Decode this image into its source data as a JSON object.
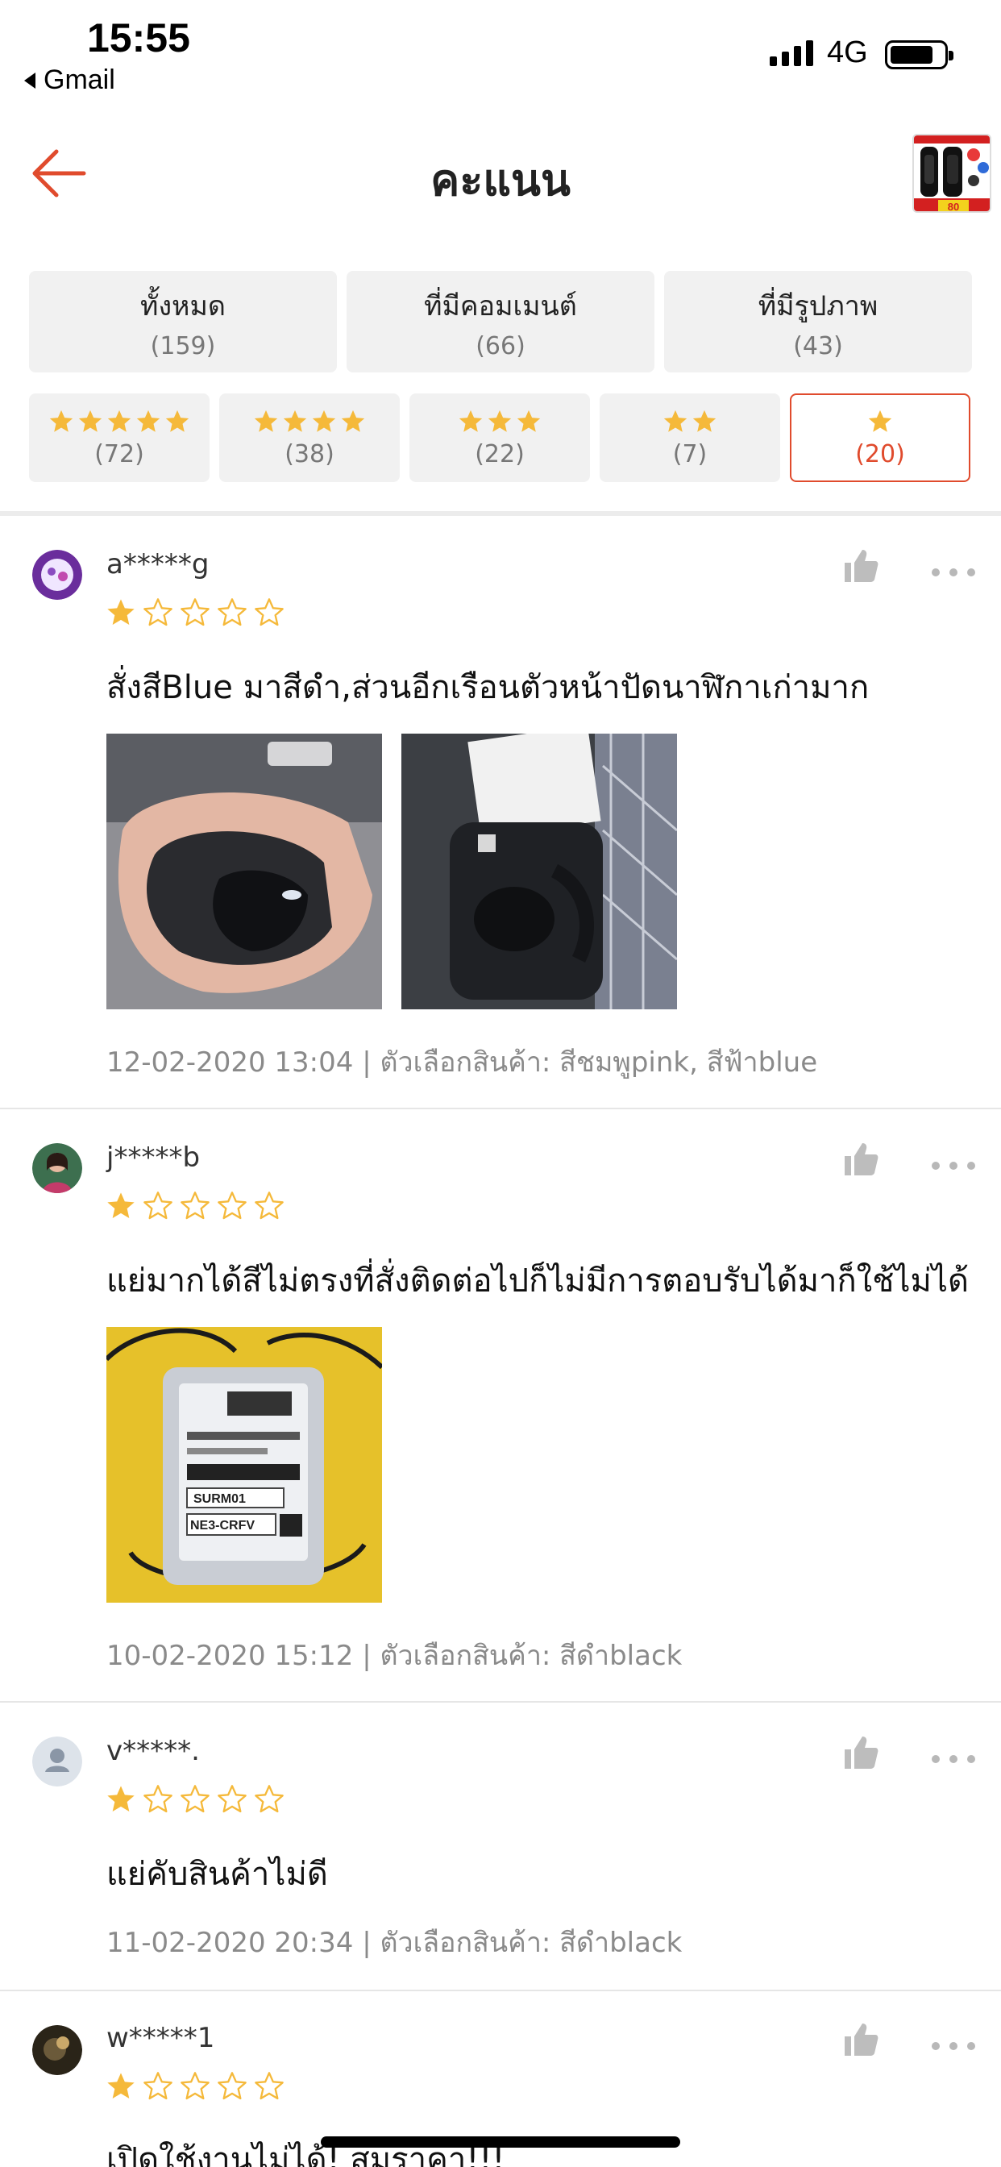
{
  "status_bar": {
    "time": "15:55",
    "back_app": "Gmail",
    "network": "4G"
  },
  "header": {
    "title": "คะแนน",
    "product_thumb_text": "80"
  },
  "filters": {
    "top": [
      {
        "label": "ทั้งหมด",
        "count": "(159)"
      },
      {
        "label": "ที่มีคอมเมนต์",
        "count": "(66)"
      },
      {
        "label": "ที่มีรูปภาพ",
        "count": "(43)"
      }
    ],
    "stars": [
      {
        "stars": 5,
        "count": "(72)",
        "active": false
      },
      {
        "stars": 4,
        "count": "(38)",
        "active": false
      },
      {
        "stars": 3,
        "count": "(22)",
        "active": false
      },
      {
        "stars": 2,
        "count": "(7)",
        "active": false
      },
      {
        "stars": 1,
        "count": "(20)",
        "active": true
      }
    ]
  },
  "reviews": [
    {
      "username": "a*****g",
      "rating": 1,
      "text": "สั่งสีBlue มาสีดำ,ส่วนอีกเรือนตัวหน้าปัดนาฬิกาเก่ามาก",
      "photo_count": 2,
      "meta": "12-02-2020 13:04 | ตัวเลือกสินค้า: สีชมพูpink, สีฟ้าblue"
    },
    {
      "username": "j*****b",
      "rating": 1,
      "text": "แย่มากได้สีไม่ตรงที่สั่งติดต่อไปก็ไม่มีการตอบรับได้มาก็ใช้ไม่ได้",
      "photo_count": 1,
      "photo_label_1": "SURM01",
      "photo_label_2": "NE3-CRFV",
      "meta": "10-02-2020 15:12 | ตัวเลือกสินค้า: สีดำblack"
    },
    {
      "username": "v*****.",
      "rating": 1,
      "text": "แย่คับสินค้าไม่ดี",
      "photo_count": 0,
      "meta": "11-02-2020 20:34 | ตัวเลือกสินค้า: สีดำblack"
    },
    {
      "username": "w*****1",
      "rating": 1,
      "text": "เปิดใช้งานไม่ได้! สมราคา!!!",
      "photo_count": 0,
      "meta": ""
    }
  ],
  "colors": {
    "accent": "#e04b2d",
    "star": "#f5b93a",
    "chip_bg": "#f1f1f1"
  },
  "icons": [
    "back-arrow-icon",
    "signal-icon",
    "battery-icon",
    "thumbs-up-icon",
    "more-dots-icon",
    "star-filled-icon",
    "star-outline-icon",
    "user-placeholder-icon"
  ]
}
